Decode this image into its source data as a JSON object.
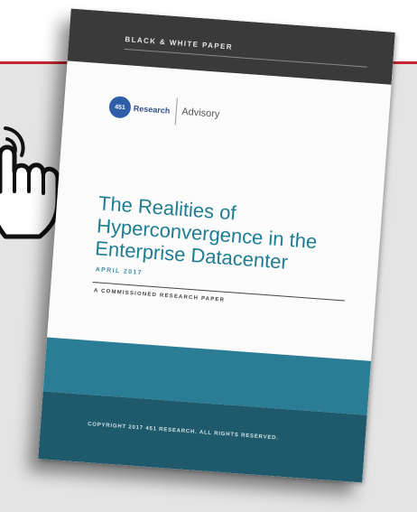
{
  "cover": {
    "series_label": "BLACK & WHITE PAPER",
    "logo": {
      "mark": "451",
      "word": "Research",
      "division": "Advisory"
    },
    "title_line1": "The Realities of",
    "title_line2": "Hyperconvergence in the",
    "title_line3": "Enterprise Datacenter",
    "date": "APRIL 2017",
    "subtitle": "A COMMISSIONED RESEARCH PAPER",
    "copyright": "COPYRIGHT 2017 451 RESEARCH. ALL RIGHTS RESERVED."
  },
  "icons": {
    "hand": "tap-hand-icon"
  },
  "colors": {
    "accent_red": "#c4262e",
    "title_teal": "#1f7d92",
    "band_dark": "#3a3a3a",
    "footer_teal": "#2a7d94",
    "footer_dark": "#1e5a6c",
    "logo_blue": "#2f5ea8"
  }
}
